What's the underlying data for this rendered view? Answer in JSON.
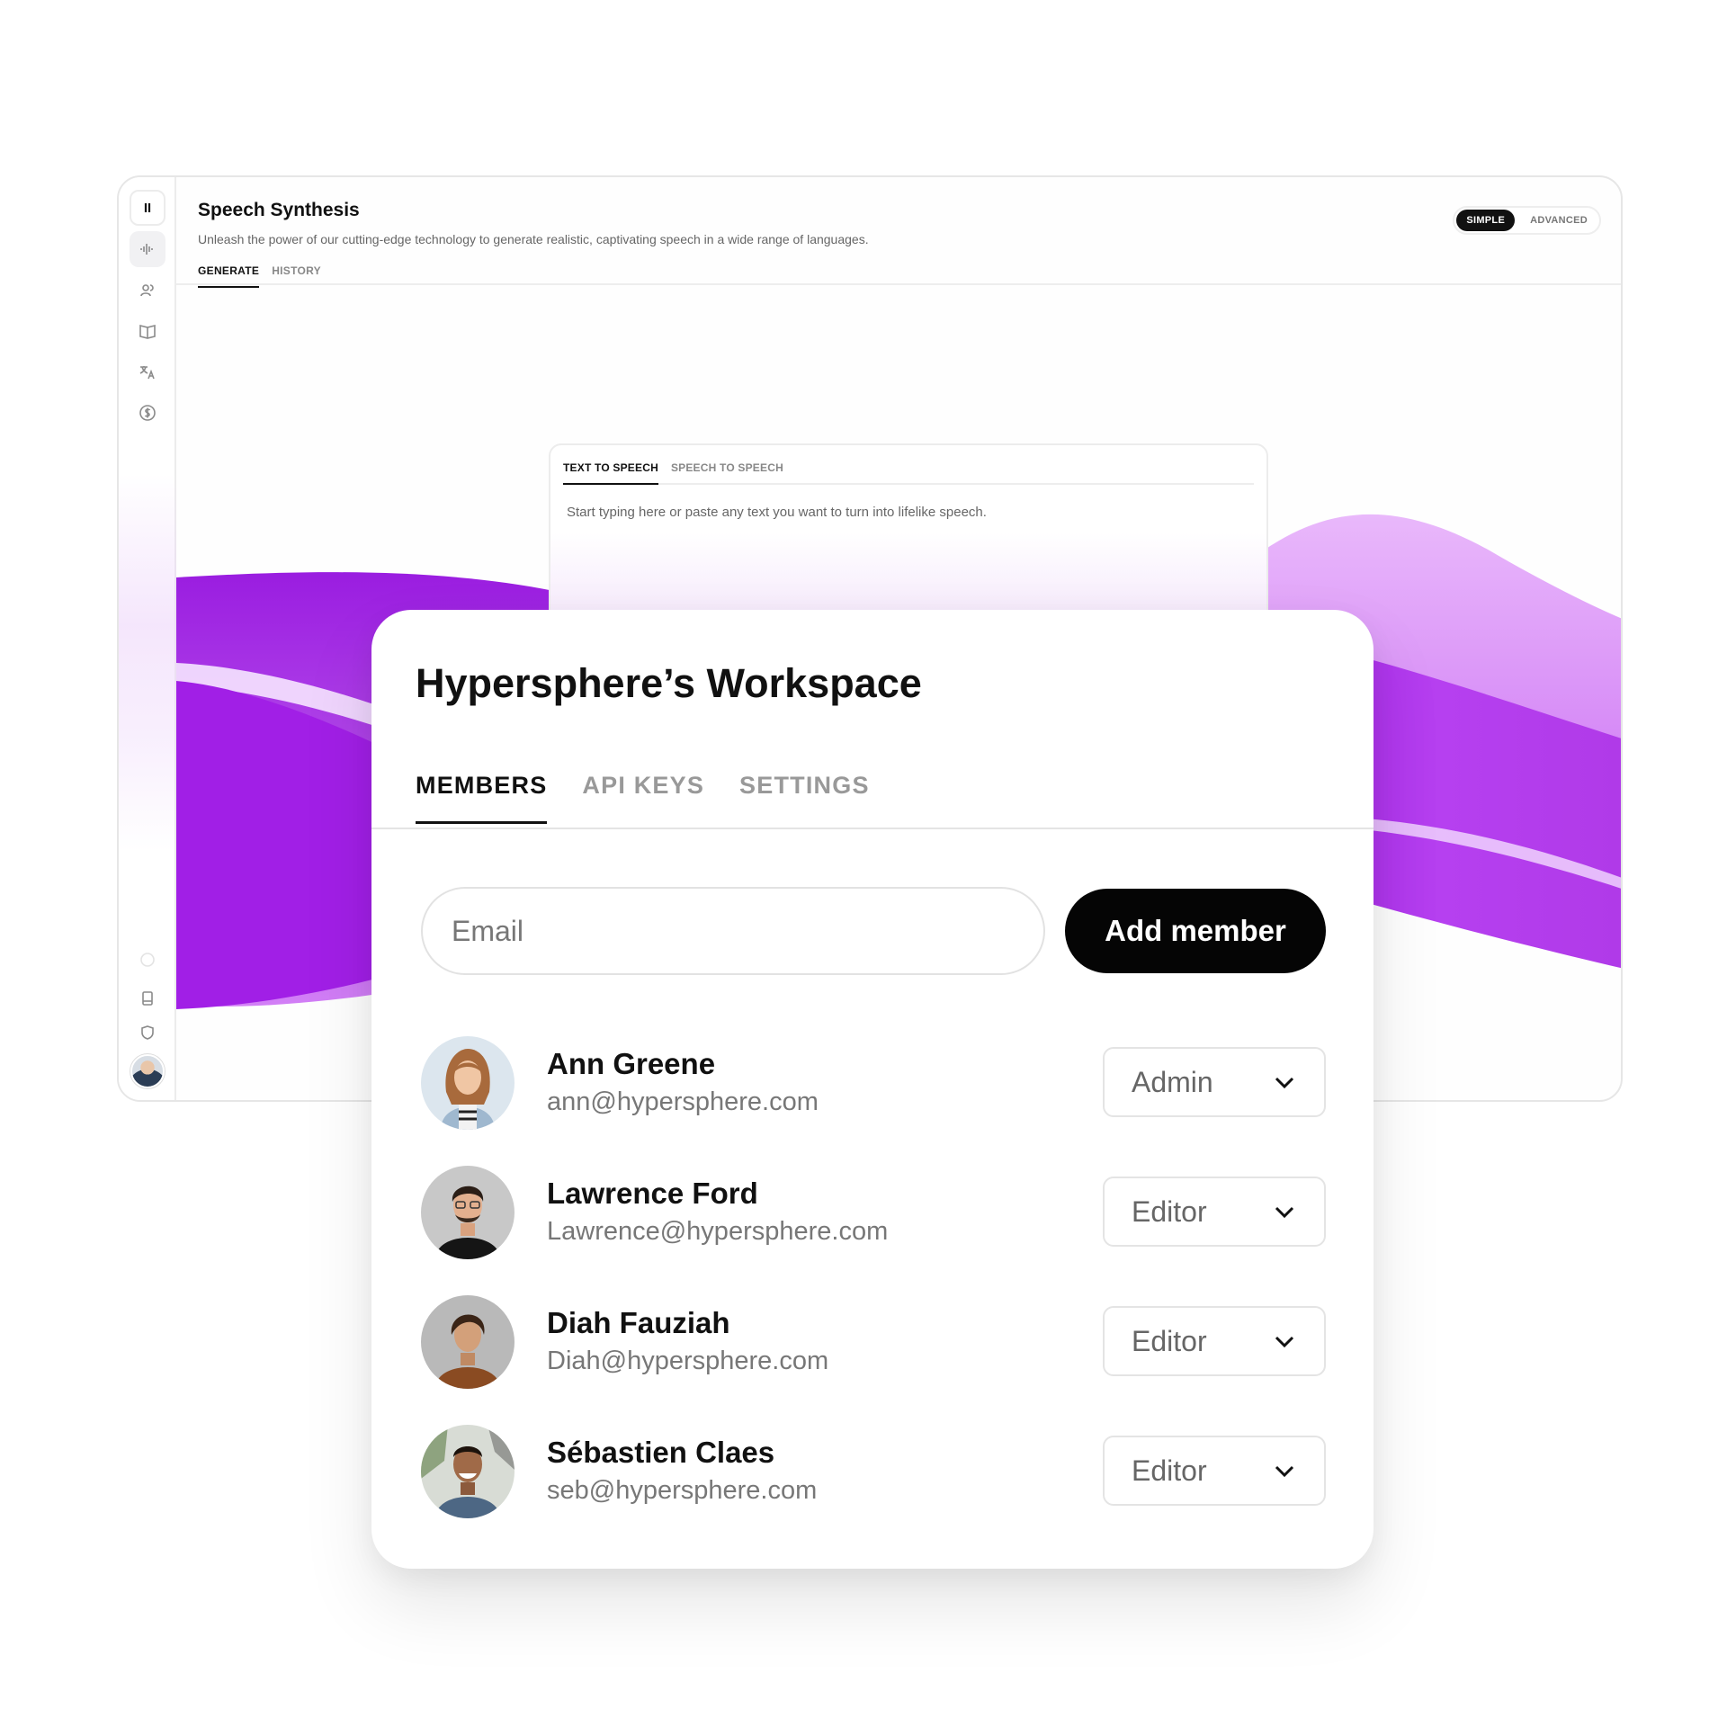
{
  "app": {
    "title": "Speech Synthesis",
    "subtitle": "Unleash the power of our cutting-edge technology to generate realistic, captivating speech in a wide range of languages.",
    "tabs": [
      {
        "label": "GENERATE",
        "active": true
      },
      {
        "label": "HISTORY",
        "active": false
      }
    ],
    "modes": [
      {
        "label": "SIMPLE",
        "active": true
      },
      {
        "label": "ADVANCED",
        "active": false
      }
    ],
    "sidebar_icons": [
      "pause-icon",
      "waveform-icon",
      "users-icon",
      "book-icon",
      "translate-icon",
      "dollar-icon",
      "circle-icon",
      "document-icon",
      "shield-icon"
    ],
    "accent_color": "#a020f0"
  },
  "tts": {
    "tabs": [
      {
        "label": "TEXT TO SPEECH",
        "active": true
      },
      {
        "label": "SPEECH TO SPEECH",
        "active": false
      }
    ],
    "placeholder": "Start typing here or paste any text you want to turn into lifelike speech."
  },
  "workspace": {
    "title": "Hypersphere’s Workspace",
    "tabs": [
      {
        "label": "MEMBERS",
        "active": true
      },
      {
        "label": "API KEYS",
        "active": false
      },
      {
        "label": "SETTINGS",
        "active": false
      }
    ],
    "email_placeholder": "Email",
    "add_button": "Add member",
    "members": [
      {
        "name": "Ann Greene",
        "email": "ann@hypersphere.com",
        "role": "Admin"
      },
      {
        "name": "Lawrence Ford",
        "email": "Lawrence@hypersphere.com",
        "role": "Editor"
      },
      {
        "name": "Diah Fauziah",
        "email": "Diah@hypersphere.com",
        "role": "Editor"
      },
      {
        "name": "Sébastien Claes",
        "email": "seb@hypersphere.com",
        "role": "Editor"
      }
    ]
  }
}
